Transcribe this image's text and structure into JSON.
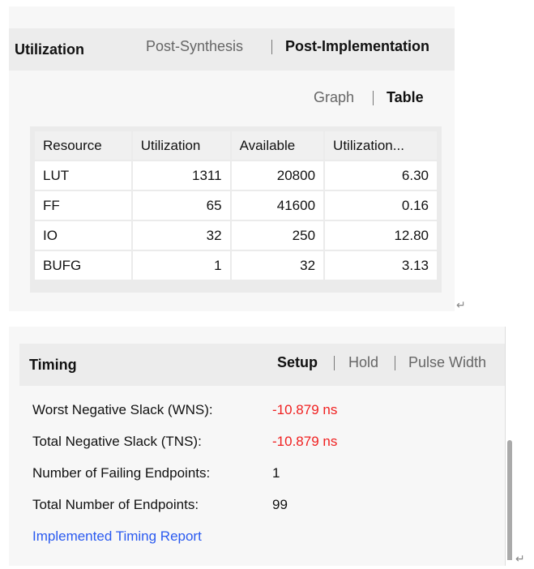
{
  "utilization": {
    "title": "Utilization",
    "tabs": [
      {
        "label": "Post-Synthesis",
        "active": false
      },
      {
        "label": "Post-Implementation",
        "active": true
      }
    ],
    "view_tabs": [
      {
        "label": "Graph",
        "active": false
      },
      {
        "label": "Table",
        "active": true
      }
    ],
    "table": {
      "headers": [
        "Resource",
        "Utilization",
        "Available",
        "Utilization..."
      ],
      "rows": [
        [
          "LUT",
          "1311",
          "20800",
          "6.30"
        ],
        [
          "FF",
          "65",
          "41600",
          "0.16"
        ],
        [
          "IO",
          "32",
          "250",
          "12.80"
        ],
        [
          "BUFG",
          "1",
          "32",
          "3.13"
        ]
      ]
    }
  },
  "timing": {
    "title": "Timing",
    "tabs": [
      {
        "label": "Setup",
        "active": true
      },
      {
        "label": "Hold",
        "active": false
      },
      {
        "label": "Pulse Width",
        "active": false
      }
    ],
    "metrics": [
      {
        "label": "Worst Negative Slack (WNS):",
        "value": "-10.879 ns",
        "status": "fail"
      },
      {
        "label": "Total Negative Slack (TNS):",
        "value": "-10.879 ns",
        "status": "fail"
      },
      {
        "label": "Number of Failing Endpoints:",
        "value": "1"
      },
      {
        "label": "Total Number of Endpoints:",
        "value": "99"
      }
    ],
    "report_link": "Implemented Timing Report"
  },
  "colors": {
    "fail": "#f02020",
    "link": "#2a5af0"
  },
  "return_mark": "↵"
}
